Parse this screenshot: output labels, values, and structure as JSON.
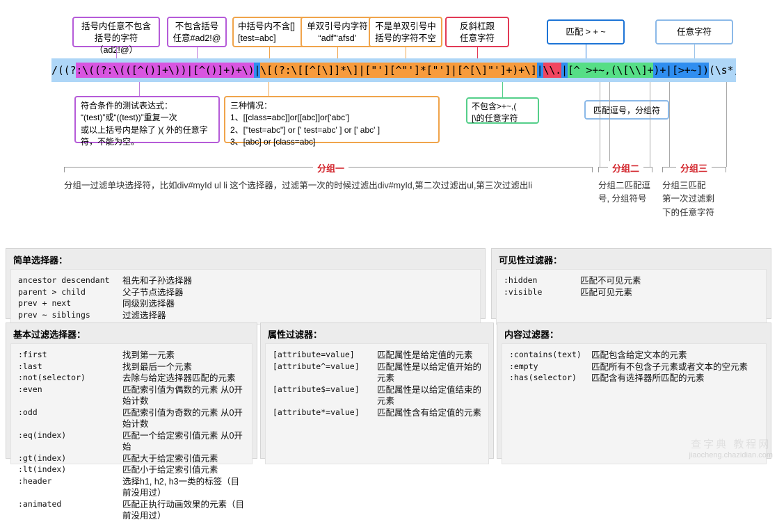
{
  "regex": {
    "segments": [
      {
        "text": "/((?",
        "style": "plain"
      },
      {
        "text": ":\\((?:\\(([^()]+\\))|[^()]+)+\\)",
        "style": "purple"
      },
      {
        "text": "|",
        "style": "blue"
      },
      {
        "text": "\\[(?:\\[[^[\\]]*\\]|[\"'][^\"']*[\"']|[^[\\]\"']+)+\\]",
        "style": "orange"
      },
      {
        "text": "|",
        "style": "blue"
      },
      {
        "text": "\\\\.",
        "style": "red"
      },
      {
        "text": "|",
        "style": "blue"
      },
      {
        "text": "[^ >+~,(\\[\\\\]+",
        "style": "green"
      },
      {
        "text": ")+",
        "style": "blue"
      },
      {
        "text": "|",
        "style": "blue"
      },
      {
        "text": "[>+~])",
        "style": "blue"
      },
      {
        "text": "(\\s*,\\s*)?((?:.|\\r|\\n)*)/g,",
        "style": "plain"
      }
    ],
    "full": "/((?:\\((?:\\(([^()]+\\))|[^()]+)+\\))|\\[(?:\\[[^[\\]]*\\]|[\"'][^\"']*[\"']|[^[\\]\"']+)+\\]|\\\\.|[^ >+~,(\\[\\\\]+)+|[>+~])(\\s*,\\s*)?((?:.|\\r|\\n)*)/g,"
  },
  "callouts_top": [
    {
      "id": "paren-any-no-paren",
      "text": "括号内任意不包含\n括号的字符（ad2!@）",
      "color": "purple"
    },
    {
      "id": "no-paren-any",
      "text": "不包含括号\n任意#ad2!@",
      "color": "purple"
    },
    {
      "id": "bracket-no-bracket",
      "text": "中括号内不含[]\n[test=abc]",
      "color": "orange"
    },
    {
      "id": "quote-chars",
      "text": "单双引号内字符\n“adf”‘afsd’",
      "color": "orange"
    },
    {
      "id": "not-quote-bracket",
      "text": "不是单双引号中\n括号的字符不空",
      "color": "orange"
    },
    {
      "id": "backslash-any",
      "text": "反斜杠跟\n任意字符",
      "color": "red"
    },
    {
      "id": "match-combinators",
      "text": "匹配 > + ~",
      "color": "blue"
    },
    {
      "id": "any-char",
      "text": "任意字符",
      "color": "lightblue"
    }
  ],
  "callouts_bottom": [
    {
      "id": "test-expression",
      "text": "符合条件的测试表达式：\n“(test)”或“((test))”重复一次\n或以上括号内是除了 )( 外的任意字\n符，不能为空。",
      "color": "purple"
    },
    {
      "id": "three-cases",
      "text": "三种情况：\n1、[[class=abc]]or[[abc]]or[‘abc’]\n2、[\"test=abc\"] or [' test=abc' ] or [' abc' ]\n3、[abc] or  [class=abc]",
      "color": "orange"
    },
    {
      "id": "not-contains",
      "text": "不包含>+~,(\n[\\的任意字符",
      "color": "green"
    },
    {
      "id": "match-comma",
      "text": "匹配逗号，分组符",
      "color": "lightblue"
    }
  ],
  "groups": [
    {
      "id": "group-one",
      "label": "分组一",
      "desc": "分组一过滤单块选择符，比如div#myId ul li 这个选择器，过滤第一次的时候过滤出div#myId,第二次过滤出ul,第三次过滤出li"
    },
    {
      "id": "group-two",
      "label": "分组二",
      "desc": "分组二匹配逗\n号, 分组符号"
    },
    {
      "id": "group-three",
      "label": "分组三",
      "desc": "分组三匹配\n第一次过滤剩\n下的任意字符"
    }
  ],
  "panels": [
    {
      "id": "simple-selectors",
      "title": "简单选择器：",
      "rows": [
        {
          "key": "ancestor descendant",
          "value": "祖先和子孙选择器"
        },
        {
          "key": "parent > child",
          "value": "父子节点选择器"
        },
        {
          "key": "prev + next",
          "value": "同级别选择器"
        },
        {
          "key": "prev ~ siblings",
          "value": "过滤选择器"
        }
      ]
    },
    {
      "id": "visibility-filters",
      "title": "可见性过滤器：",
      "rows": [
        {
          "key": ":hidden",
          "value": "匹配不可见元素"
        },
        {
          "key": ":visible",
          "value": "匹配可见元素"
        }
      ]
    },
    {
      "id": "basic-filters",
      "title": "基本过滤选择器：",
      "rows": [
        {
          "key": ":first",
          "value": "找到第一元素"
        },
        {
          "key": ":last",
          "value": "找到最后一个元素"
        },
        {
          "key": ":not(selector)",
          "value": "去除与给定选择器匹配的元素"
        },
        {
          "key": ":even",
          "value": "匹配索引值为偶数的元素 从0开始计数"
        },
        {
          "key": ":odd",
          "value": "匹配索引值为奇数的元素 从0开始计数"
        },
        {
          "key": ":eq(index)",
          "value": "匹配一个给定索引值元素 从0开始"
        },
        {
          "key": ":gt(index)",
          "value": "匹配大于给定索引值元素"
        },
        {
          "key": ":lt(index)",
          "value": "匹配小于给定索引值元素"
        },
        {
          "key": ":header",
          "value": "选择h1, h2, h3一类的标签（目前没用过）"
        },
        {
          "key": ":animated",
          "value": "匹配正执行动画效果的元素（目前没用过）"
        }
      ]
    },
    {
      "id": "attribute-filters",
      "title": "属性过滤器：",
      "rows": [
        {
          "key": "[attribute=value]",
          "value": "匹配属性是给定值的元素"
        },
        {
          "key": "[attribute^=value]",
          "value": "匹配属性是以给定值开始的元素"
        },
        {
          "key": "[attribute$=value]",
          "value": "匹配属性是以给定值结束的元素"
        },
        {
          "key": "[attribute*=value]",
          "value": "匹配属性含有给定值的元素"
        }
      ]
    },
    {
      "id": "content-filters",
      "title": "内容过滤器：",
      "rows": [
        {
          "key": ":contains(text)",
          "value": "匹配包含给定文本的元素"
        },
        {
          "key": ":empty",
          "value": "匹配所有不包含子元素或者文本的空元素"
        },
        {
          "key": ":has(selector)",
          "value": "匹配含有选择器所匹配的元素"
        }
      ]
    }
  ],
  "watermark": {
    "brand": "查字典 教程网",
    "url": "jiaocheng.chazidian.com"
  },
  "colors": {
    "purple": "#d855e0",
    "orange": "#f79b3c",
    "red": "#f0455f",
    "green": "#56de86",
    "blue": "#2f8ef0",
    "strip_bg": "#aed6f7",
    "group_label": "#d2232a"
  }
}
